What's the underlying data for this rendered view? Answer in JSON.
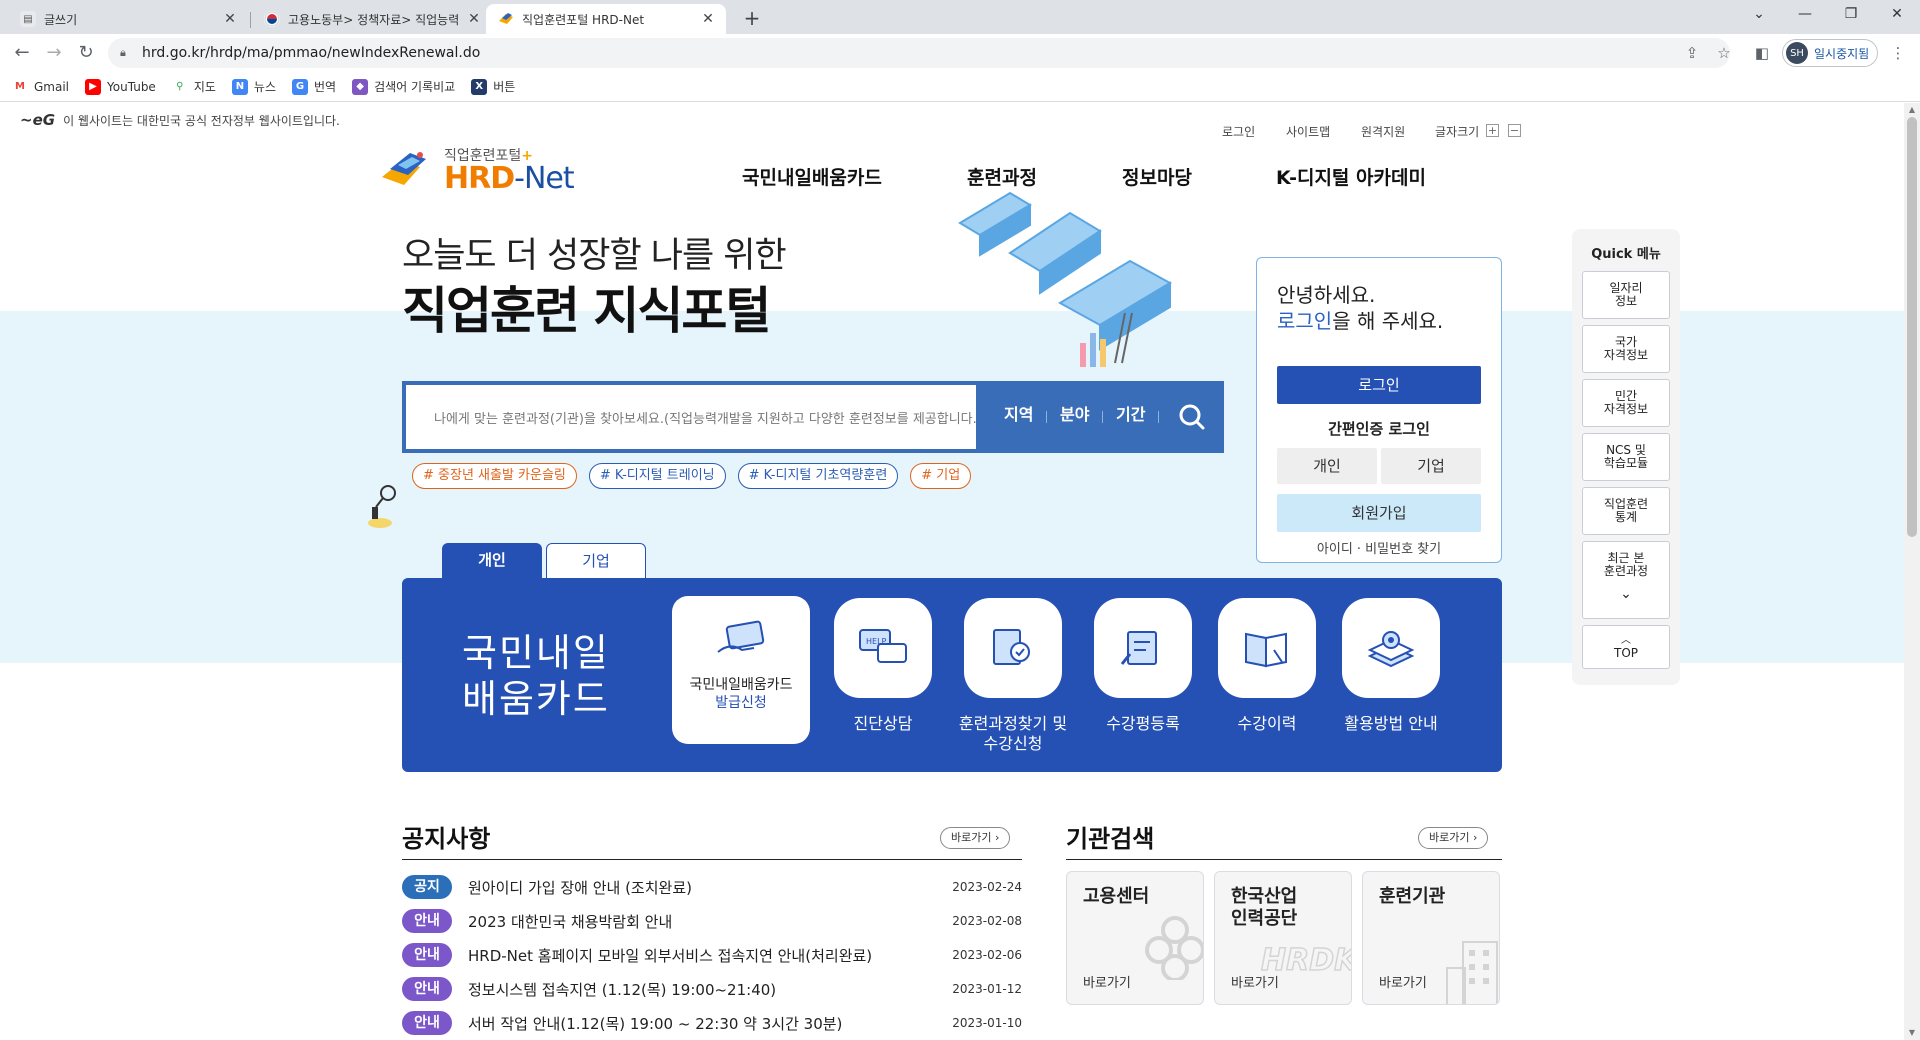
{
  "browser": {
    "tabs": [
      {
        "title": "글쓰기",
        "favicon": "blog-icon"
      },
      {
        "title": "고용노동부> 정책자료> 직업능력",
        "favicon": "korea-flag-icon"
      },
      {
        "title": "직업훈련포털 HRD-Net",
        "favicon": "hrd-icon"
      }
    ],
    "url": "hrd.go.kr/hrdp/ma/pmmao/newIndexRenewal.do",
    "profile_initials": "SH",
    "profile_label": "일시중지됨",
    "bookmarks": [
      "Gmail",
      "YouTube",
      "지도",
      "뉴스",
      "번역",
      "검색어 기록비교",
      "버튼"
    ]
  },
  "site": {
    "gov_notice": "이 웹사이트는 대한민국 공식 전자정부 웹사이트입니다.",
    "logo_sub": "직업훈련포털",
    "logo_main_hrd": "HRD",
    "logo_main_net": "-Net",
    "util": [
      "로그인",
      "사이트맵",
      "원격지원",
      "글자크기"
    ],
    "gnb": [
      "국민내일배움카드",
      "훈련과정",
      "정보마당",
      "K-디지털 아카데미"
    ],
    "hero_line1": "오늘도 더 성장할 나를 위한",
    "hero_line2": "직업훈련 지식포털",
    "search_placeholder": "나에게 맞는 훈련과정(기관)을 찾아보세요.(직업능력개발을 지원하고 다양한 훈련정보를 제공합니다.)",
    "search_chips": [
      "지역",
      "분야",
      "기간"
    ],
    "hashtags": [
      {
        "text": "# 중장년 새출발 카운슬링",
        "tone": "orange"
      },
      {
        "text": "# K-디지털 트레이닝",
        "tone": "blue"
      },
      {
        "text": "# K-디지털 기초역량훈련",
        "tone": "blue"
      },
      {
        "text": "# 기업",
        "tone": "orange"
      }
    ]
  },
  "login_box": {
    "greeting": "안녕하세요.",
    "login_link": "로그인",
    "greeting_tail": "을 해 주세요.",
    "login_button": "로그인",
    "easy_login": "간편인증 로그인",
    "personal": "개인",
    "company": "기업",
    "join": "회원가입",
    "find": "아이디 · 비밀번호 찾기"
  },
  "quick_menu": {
    "title": "Quick 메뉴",
    "items": [
      "일자리\n정보",
      "국가\n자격정보",
      "민간\n자격정보",
      "NCS 및\n학습모듈",
      "직업훈련\n통계",
      "최근 본\n훈련과정"
    ],
    "top": "TOP"
  },
  "card_section": {
    "tabs": [
      "개인",
      "기업"
    ],
    "big_title_1": "국민내일",
    "big_title_2": "배움카드",
    "featured_line1": "국민내일배움카드",
    "featured_line2": "발급신청",
    "services": [
      "진단상담",
      "훈련과정찾기 및\n수강신청",
      "수강평등록",
      "수강이력",
      "활용방법 안내"
    ]
  },
  "notice": {
    "title": "공지사항",
    "more": "바로가기",
    "items": [
      {
        "badge": "공지",
        "text": "원아이디 가입 장애 안내 (조치완료)",
        "date": "2023-02-24"
      },
      {
        "badge": "안내",
        "text": "2023 대한민국 채용박람회 안내",
        "date": "2023-02-08"
      },
      {
        "badge": "안내",
        "text": "HRD-Net 홈페이지 모바일 외부서비스 접속지연 안내(처리완료)",
        "date": "2023-02-06"
      },
      {
        "badge": "안내",
        "text": "정보시스템 접속지연 (1.12(목) 19:00~21:40)",
        "date": "2023-01-12"
      },
      {
        "badge": "안내",
        "text": "서버 작업 안내(1.12(목) 19:00 ~ 22:30 약 3시간 30분)",
        "date": "2023-01-10"
      }
    ]
  },
  "org_search": {
    "title": "기관검색",
    "more": "바로가기",
    "items": [
      {
        "name": "고용센터",
        "go": "바로가기"
      },
      {
        "name": "한국산업\n인력공단",
        "go": "바로가기"
      },
      {
        "name": "훈련기관",
        "go": "바로가기"
      }
    ]
  },
  "colors": {
    "primary": "#2550b4",
    "accent": "#f07c00",
    "band": "#e6f4fb",
    "notice_badge": "#2a6fb8",
    "info_badge": "#7b57c9"
  }
}
